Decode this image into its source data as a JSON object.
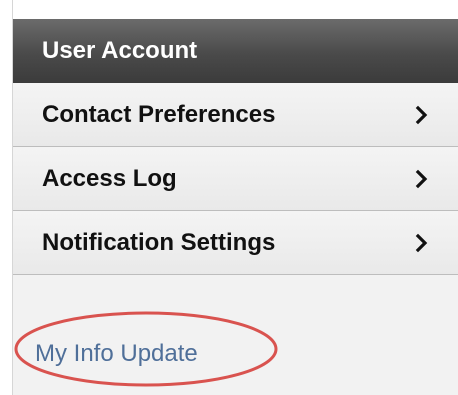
{
  "panel": {
    "header": {
      "title": "User Account"
    },
    "items": [
      {
        "label": "Contact Preferences",
        "icon": "chevron-right-icon"
      },
      {
        "label": "Access Log",
        "icon": "chevron-right-icon"
      },
      {
        "label": "Notification Settings",
        "icon": "chevron-right-icon"
      }
    ],
    "link": {
      "label": "My Info Update"
    },
    "annotation": {
      "shape": "ellipse",
      "color": "#d9534f"
    }
  }
}
